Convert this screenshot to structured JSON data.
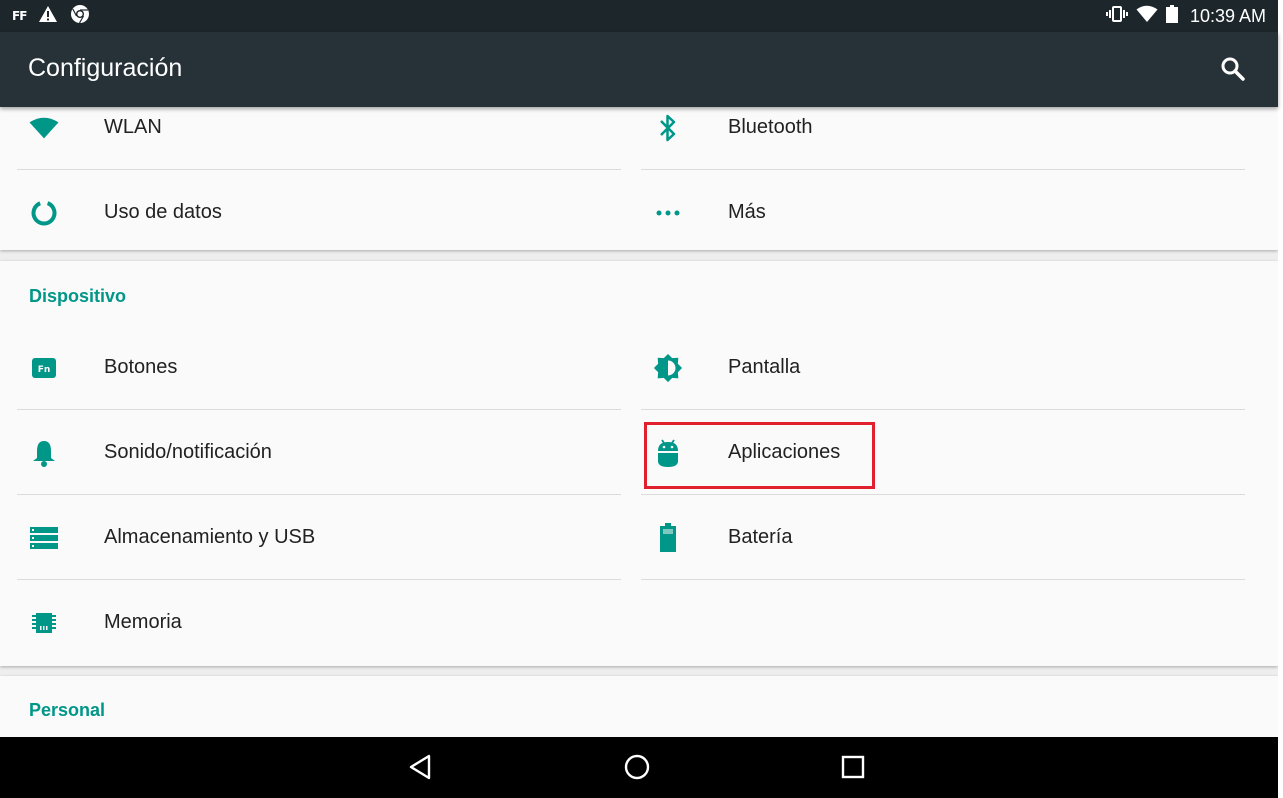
{
  "status_bar": {
    "left_text": "FF",
    "clock": "10:39 AM",
    "icons": [
      "ff-app-icon",
      "warning-icon",
      "chrome-icon",
      "vibrate-icon",
      "wifi-icon",
      "battery-icon"
    ]
  },
  "app_bar": {
    "title": "Configuración",
    "search_icon": "search-icon"
  },
  "wireless": {
    "items": [
      {
        "label": "WLAN",
        "icon": "wifi-icon"
      },
      {
        "label": "Bluetooth",
        "icon": "bluetooth-icon"
      },
      {
        "label": "Uso de datos",
        "icon": "data-usage-icon"
      },
      {
        "label": "Más",
        "icon": "more-icon"
      }
    ]
  },
  "device": {
    "title": "Dispositivo",
    "items": [
      {
        "label": "Botones",
        "icon": "fn-key-icon"
      },
      {
        "label": "Pantalla",
        "icon": "brightness-icon"
      },
      {
        "label": "Sonido/notificación",
        "icon": "bell-icon"
      },
      {
        "label": "Aplicaciones",
        "icon": "android-icon"
      },
      {
        "label": "Almacenamiento y USB",
        "icon": "storage-icon"
      },
      {
        "label": "Batería",
        "icon": "battery-icon"
      },
      {
        "label": "Memoria",
        "icon": "memory-chip-icon"
      }
    ]
  },
  "personal": {
    "title": "Personal"
  },
  "fn_icon_text": "Fn",
  "colors": {
    "accent": "#009688",
    "app_bar": "#263238",
    "status_bar": "#1d262a",
    "highlight": "#e0202e"
  },
  "nav_bar": {
    "icons": [
      "back-icon",
      "home-icon",
      "recents-icon"
    ]
  }
}
